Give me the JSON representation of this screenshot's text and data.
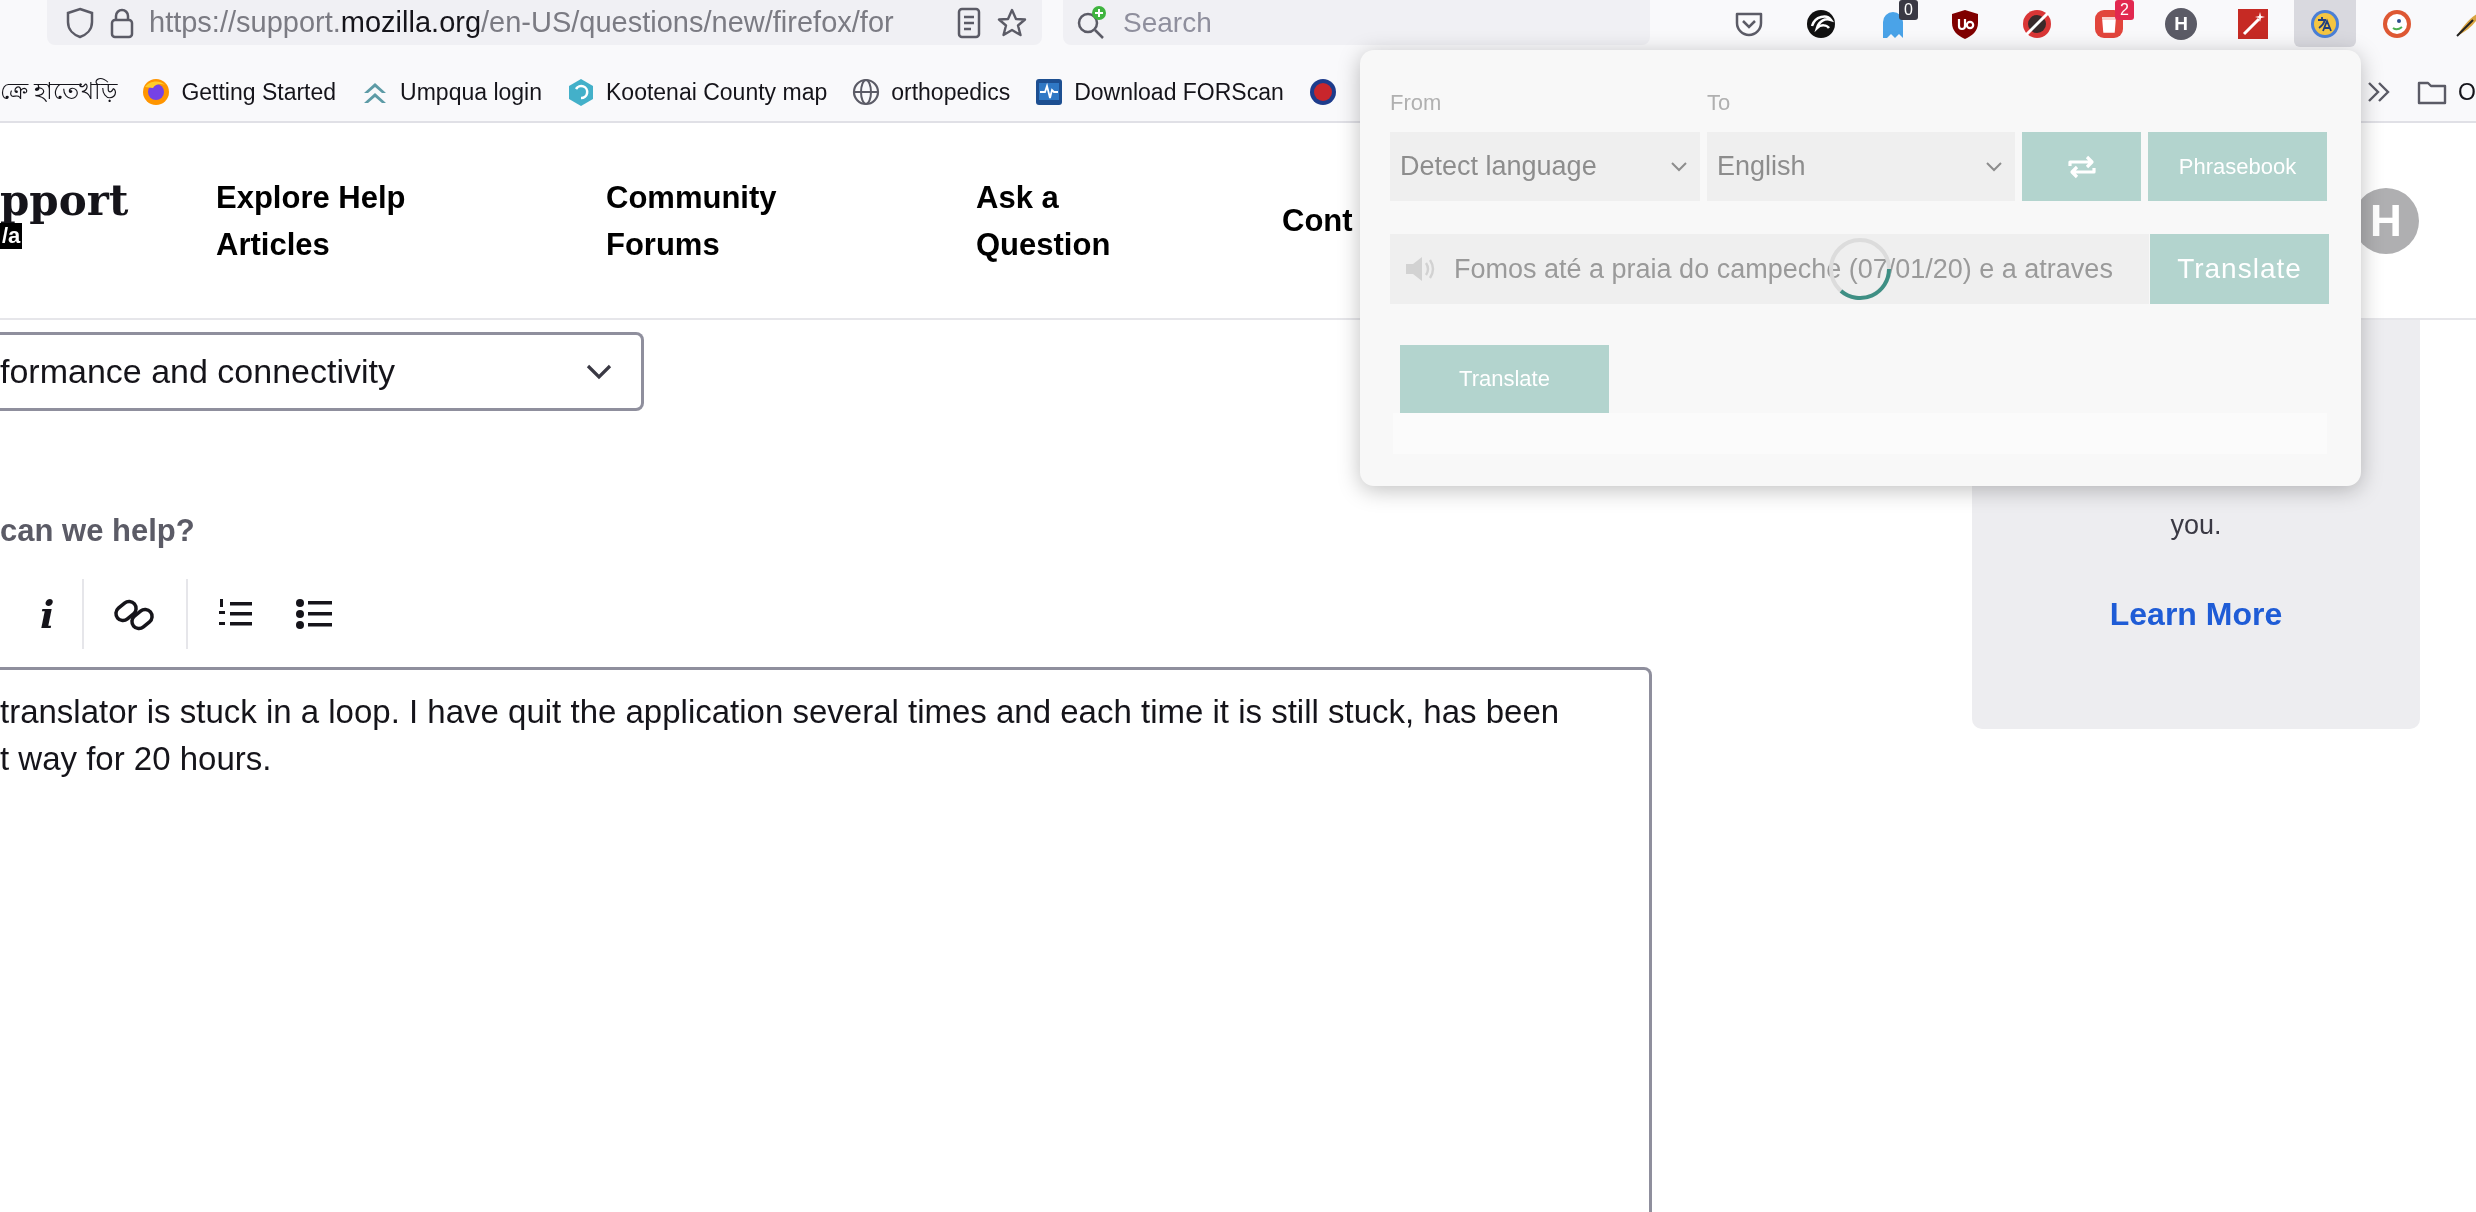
{
  "toolbar": {
    "url": {
      "prefix": "https://support.",
      "domain": "mozilla.org",
      "path": "/en-US/questions/new/firefox/for"
    },
    "search": {
      "placeholder": "Search"
    },
    "extensions": [
      {
        "kind": "pocket",
        "selected": false
      },
      {
        "kind": "swirl",
        "selected": false
      },
      {
        "kind": "ghost",
        "badge": "0",
        "selected": false
      },
      {
        "kind": "shield",
        "selected": false
      },
      {
        "kind": "blocked",
        "selected": false
      },
      {
        "kind": "trash",
        "badge": "2",
        "selected": false
      },
      {
        "kind": "letter",
        "label": "H",
        "selected": false
      },
      {
        "kind": "wand",
        "selected": false
      },
      {
        "kind": "translate",
        "selected": true
      },
      {
        "kind": "duck",
        "selected": false
      },
      {
        "kind": "feather",
        "selected": false
      }
    ]
  },
  "bookmarks": {
    "items": [
      {
        "kind": "none",
        "label": "ক্রে হাতেখড়ি"
      },
      {
        "kind": "firefox",
        "label": "Getting Started"
      },
      {
        "kind": "arrows",
        "label": "Umpqua login"
      },
      {
        "kind": "hexagon",
        "label": "Kootenai County map"
      },
      {
        "kind": "globe",
        "label": "orthopedics"
      },
      {
        "kind": "monitor",
        "label": "Download FORScan"
      },
      {
        "kind": "roundel"
      }
    ],
    "folder": {
      "label": "O"
    }
  },
  "header": {
    "logo": {
      "title": "pport",
      "tag": "/a"
    },
    "nav": [
      "Explore Help\nArticles",
      "Community\nForums",
      "Ask a\nQuestion",
      "Cont"
    ],
    "avatar": "H"
  },
  "main": {
    "topic_select": {
      "value": "formance and connectivity"
    },
    "question_heading": "can we help?",
    "editor_tool_groups": [
      [
        {
          "kind": "italic",
          "label": "i"
        }
      ],
      [
        {
          "kind": "link"
        }
      ],
      [
        {
          "kind": "ordered-list"
        },
        {
          "kind": "bullet-list"
        }
      ]
    ],
    "description": {
      "value": "translator is stuck in a loop. I have quit the application several times and each time it is still stuck, has been\nt way for 20 hours."
    }
  },
  "sidebar": {
    "text": "you.",
    "link": "Learn More"
  },
  "translate_popup": {
    "from_label": "From",
    "to_label": "To",
    "from_select": "Detect language",
    "to_select": "English",
    "phrasebook": "Phrasebook",
    "source": {
      "value": "Fomos até a praia do campeche (07/01/20) e a atraves"
    },
    "loading": true,
    "inline_translate": "Translate",
    "translate_button": "Translate"
  }
}
